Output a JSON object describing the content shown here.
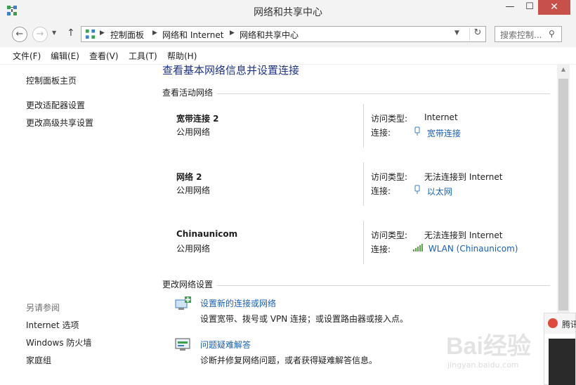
{
  "window": {
    "title": "网络和共享中心",
    "min": "—",
    "max": "☐",
    "close": "✕"
  },
  "nav": {
    "back": "←",
    "forward": "→",
    "recent": "▼",
    "up": "↑",
    "breadcrumb": [
      "控制面板",
      "网络和 Internet",
      "网络和共享中心"
    ],
    "sep": "▶",
    "dropdown": "▼",
    "refresh": "↻",
    "search_placeholder": "搜索控制...",
    "search_icon": "⚲"
  },
  "menu": [
    "文件(F)",
    "编辑(E)",
    "查看(V)",
    "工具(T)",
    "帮助(H)"
  ],
  "left": {
    "links": [
      "控制面板主页",
      "更改适配器设置",
      "更改高级共享设置"
    ],
    "see_also": "另请参阅",
    "see_also_links": [
      "Internet 选项",
      "Windows 防火墙",
      "家庭组"
    ]
  },
  "main": {
    "title": "查看基本网络信息并设置连接",
    "active_section": "查看活动网络",
    "access_label": "访问类型:",
    "conn_label": "连接:",
    "networks": [
      {
        "name": "宽带连接  2",
        "type": "公用网络",
        "access": "Internet",
        "connection": "宽带连接",
        "icon": "dialup-icon"
      },
      {
        "name": "网络  2",
        "type": "公用网络",
        "access": "无法连接到 Internet",
        "connection": "以太网",
        "icon": "ethernet-icon"
      },
      {
        "name": "Chinaunicom",
        "type": "公用网络",
        "access": "无法连接到 Internet",
        "connection": "WLAN (Chinaunicom)",
        "icon": "wifi-signal-icon"
      }
    ],
    "change_section": "更改网络设置",
    "tasks": [
      {
        "link": "设置新的连接或网络",
        "desc": "设置宽带、拨号或 VPN 连接；或设置路由器或接入点。"
      },
      {
        "link": "问题疑难解答",
        "desc": "诊断并修复网络问题，或者获得疑难解答信息。"
      }
    ]
  },
  "popup": {
    "text": "腾讯"
  },
  "watermark": {
    "text": "Bai经验",
    "sub": "jingyan.baidu.com"
  },
  "colors": {
    "link": "#1a5fb4",
    "heading": "#1e3287",
    "close": "#c7504b"
  }
}
